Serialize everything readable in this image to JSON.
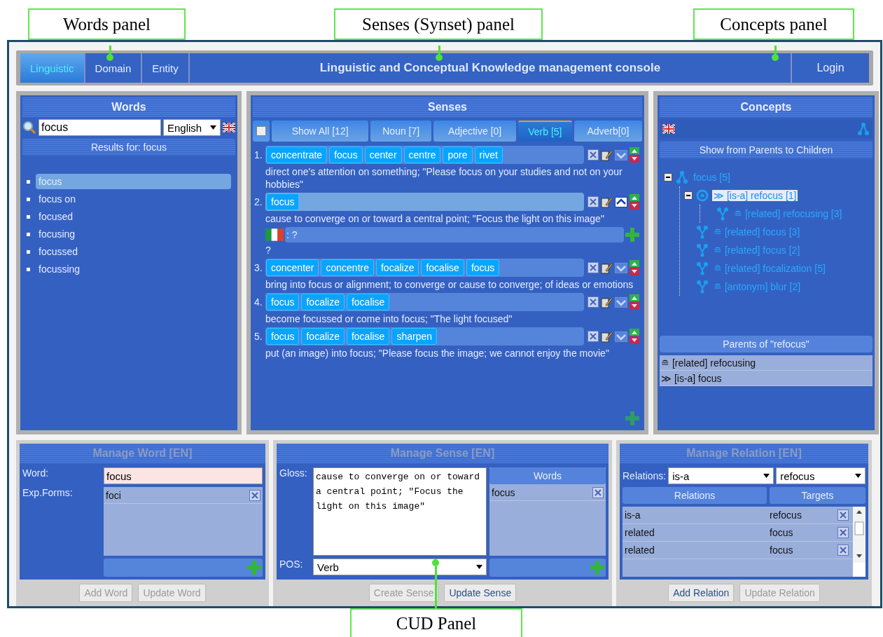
{
  "callouts": [
    {
      "label": "Words panel"
    },
    {
      "label": "Senses (Synset) panel"
    },
    {
      "label": "Concepts panel"
    },
    {
      "label": "CUD Panel"
    }
  ],
  "top_bar": {
    "tabs": [
      {
        "label": "Linguistic",
        "selected": true
      },
      {
        "label": "Domain",
        "selected": false
      },
      {
        "label": "Entity",
        "selected": false
      }
    ],
    "title": "Linguistic and Conceptual Knowledge management console",
    "login": "Login"
  },
  "words": {
    "title": "Words",
    "search": "focus",
    "language": "English",
    "results_title": "Results for: focus",
    "items": [
      {
        "label": "focus",
        "selected": true
      },
      {
        "label": "focus on",
        "selected": false
      },
      {
        "label": "focused",
        "selected": false
      },
      {
        "label": "focusing",
        "selected": false
      },
      {
        "label": "focussed",
        "selected": false
      },
      {
        "label": "focussing",
        "selected": false
      }
    ]
  },
  "senses": {
    "title": "Senses",
    "select_all": {
      "checked": false
    },
    "tabs": [
      {
        "label": "Show All [12]",
        "selected": false
      },
      {
        "label": "Noun [7]",
        "selected": false
      },
      {
        "label": "Adjective [0]",
        "selected": false
      },
      {
        "label": "Verb [5]",
        "selected": true
      },
      {
        "label": "Adverb[0]",
        "selected": false
      }
    ],
    "items": [
      {
        "number": "1.",
        "words": [
          "concentrate",
          "focus",
          "center",
          "centre",
          "pore",
          "rivet"
        ],
        "gloss": "direct one's attention on something; \"Please focus on your studies and not on your hobbies\"",
        "selected": false,
        "expanded": false
      },
      {
        "number": "2.",
        "words": [
          "focus"
        ],
        "gloss": "cause to converge on or toward a central point; \"Focus the light on this image\"",
        "selected": true,
        "expanded": true,
        "translation": {
          "value": ": ?",
          "gloss": "?"
        }
      },
      {
        "number": "3.",
        "words": [
          "concenter",
          "concentre",
          "focalize",
          "focalise",
          "focus"
        ],
        "gloss": "bring into focus or alignment; to converge or cause to converge; of ideas or emotions",
        "selected": false,
        "expanded": false
      },
      {
        "number": "4.",
        "words": [
          "focus",
          "focalize",
          "focalise"
        ],
        "gloss": "become focussed or come into focus; \"The light focused\"",
        "selected": false,
        "expanded": false
      },
      {
        "number": "5.",
        "words": [
          "focus",
          "focalize",
          "focalise",
          "sharpen"
        ],
        "gloss": "put (an image) into focus; \"Please focus the image; we cannot enjoy the movie\"",
        "selected": false,
        "expanded": false
      }
    ]
  },
  "concepts": {
    "title": "Concepts",
    "show_button": "Show from Parents to Children",
    "tree": [
      {
        "label": "focus [5]",
        "kind": "concept",
        "selected": false,
        "expanded": true,
        "children": [
          {
            "label": "≫ [is-a] refocus [1]",
            "kind": "focus",
            "selected": true,
            "expanded": true,
            "children": [
              {
                "label": "≘ [related] refocusing [3]",
                "kind": "relation",
                "selected": false
              }
            ]
          },
          {
            "label": "≘ [related] focus [3]",
            "kind": "relation",
            "selected": false
          },
          {
            "label": "≘ [related] focus [2]",
            "kind": "relation",
            "selected": false
          },
          {
            "label": "≘ [related] focalization [5]",
            "kind": "relation",
            "selected": false
          },
          {
            "label": "≘ [antonym] blur [2]",
            "kind": "relation",
            "selected": false
          }
        ]
      }
    ],
    "parents_title": "Parents of \"refocus\"",
    "parents": [
      "≘ [related] refocusing",
      "≫ [is-a] focus"
    ]
  },
  "manage_word": {
    "title": "Manage Word [EN]",
    "word_label": "Word:",
    "word": "focus",
    "forms_label": "Exp.Forms:",
    "forms": [
      "foci"
    ],
    "buttons": [
      {
        "label": "Add Word",
        "disabled": true
      },
      {
        "label": "Update Word",
        "disabled": true
      }
    ]
  },
  "manage_sense": {
    "title": "Manage Sense [EN]",
    "gloss_label": "Gloss:",
    "gloss": "cause to converge on or toward a central point; \"Focus the light on this image\"",
    "pos_label": "POS:",
    "pos": "Verb",
    "words_title": "Words",
    "words": [
      "focus"
    ],
    "buttons": [
      {
        "label": "Create Sense",
        "disabled": true
      },
      {
        "label": "Update Sense",
        "disabled": false
      }
    ]
  },
  "manage_relation": {
    "title": "Manage Relation [EN]",
    "relations_label": "Relations:",
    "relation": "is-a",
    "target": "refocus",
    "columns": [
      "Relations",
      "Targets"
    ],
    "rows": [
      [
        "is-a",
        "refocus"
      ],
      [
        "related",
        "focus"
      ],
      [
        "related",
        "focus"
      ]
    ],
    "buttons": [
      {
        "label": "Add Relation",
        "disabled": false
      },
      {
        "label": "Update Relation",
        "disabled": true
      }
    ]
  }
}
